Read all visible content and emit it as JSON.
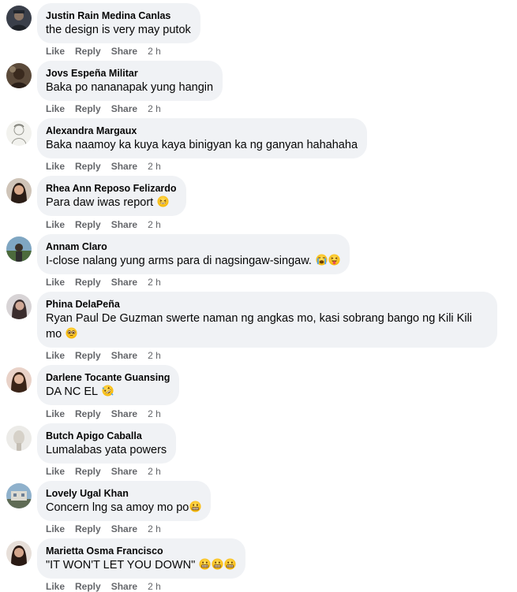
{
  "labels": {
    "like": "Like",
    "reply": "Reply",
    "share": "Share"
  },
  "comments": [
    {
      "author": "Justin Rain Medina Canlas",
      "text": "the design is very may putok",
      "time": "2 h"
    },
    {
      "author": "Jovs Espeña Militar",
      "text": "Baka po nananapak yung hangin",
      "time": "2 h"
    },
    {
      "author": "Alexandra Margaux",
      "text": "Baka naamoy ka kuya kaya binigyan ka ng ganyan hahahaha",
      "time": "2 h"
    },
    {
      "author": "Rhea Ann Reposo Felizardo",
      "text": "Para daw iwas report",
      "time": "2 h",
      "emojis": [
        "grinning-squint-face"
      ]
    },
    {
      "author": "Annam Claro",
      "text": "I-close nalang yung arms para di nagsingaw-singaw.",
      "time": "2 h",
      "emojis": [
        "crying-face",
        "squinting-tongue-face"
      ]
    },
    {
      "author": "Phina DelaPeña",
      "text": "Ryan Paul De Guzman swerte naman ng angkas mo, kasi sobrang bango ng Kili Kili mo",
      "time": "2 h",
      "emojis": [
        "pleading-face"
      ]
    },
    {
      "author": "Darlene Tocante Guansing",
      "text": "DA NC EL",
      "time": "2 h",
      "emojis": [
        "rolling-laughing-face"
      ]
    },
    {
      "author": "Butch Apigo Caballa",
      "text": "Lumalabas yata powers",
      "time": "2 h"
    },
    {
      "author": "Lovely Ugal Khan",
      "text": "Concern lng sa amoy mo po",
      "time": "2 h",
      "emojis": [
        "grimacing-face"
      ]
    },
    {
      "author": "Marietta Osma Francisco",
      "text": "\"IT WON'T LET YOU DOWN\"",
      "time": "2 h",
      "emojis": [
        "grimacing-face",
        "grimacing-face",
        "grimacing-face"
      ]
    }
  ]
}
